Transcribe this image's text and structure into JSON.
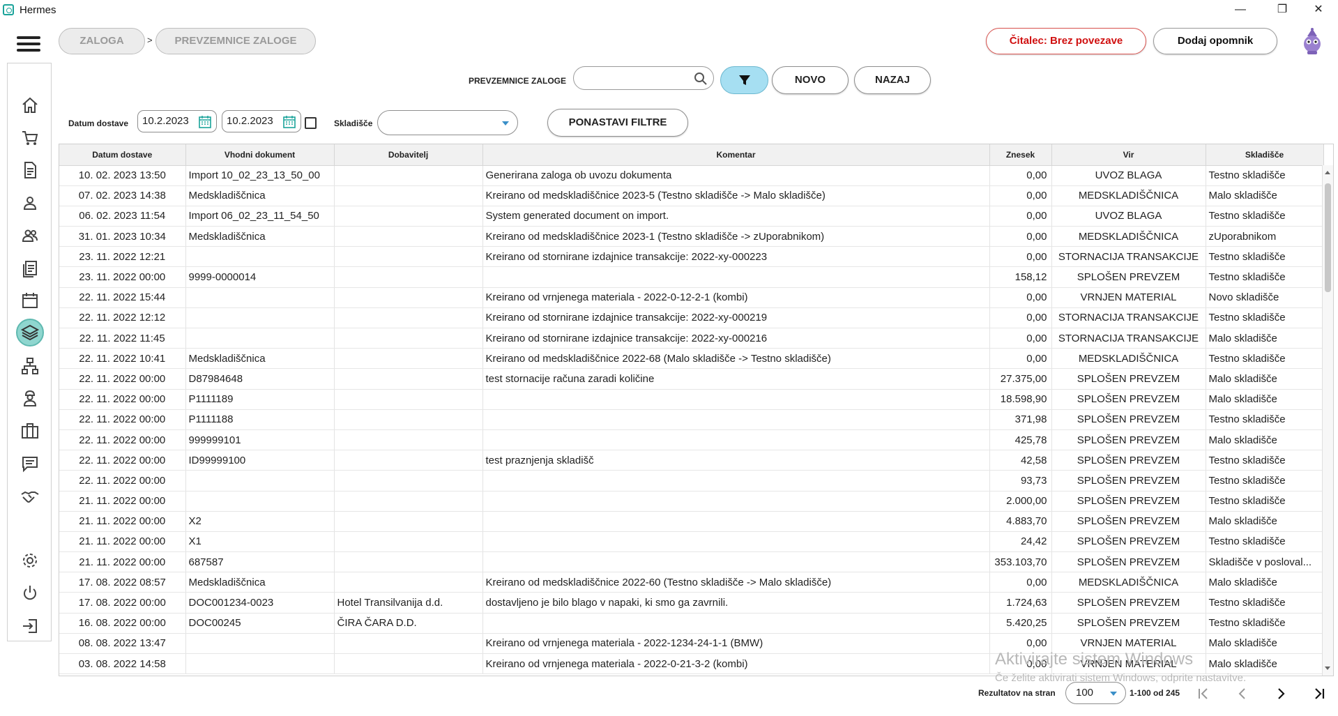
{
  "window": {
    "title": "Hermes",
    "minimize": "—",
    "restore": "❐",
    "close": "✕"
  },
  "breadcrumb": {
    "items": [
      "ZALOGA",
      "PREVZEMNICE ZALOGE"
    ],
    "separator": ">"
  },
  "header": {
    "reader_status": "Čitalec: Brez povezave",
    "reader_color": "#d01010",
    "add_reminder": "Dodaj opomnik"
  },
  "sidebar": {
    "items": [
      {
        "icon": "home-icon"
      },
      {
        "icon": "cart-icon"
      },
      {
        "icon": "document-icon"
      },
      {
        "icon": "person-icon"
      },
      {
        "icon": "people-icon"
      },
      {
        "icon": "list-icon"
      },
      {
        "icon": "calendar-icon"
      },
      {
        "icon": "layers-icon",
        "active": true
      },
      {
        "icon": "network-icon"
      },
      {
        "icon": "worker-icon"
      },
      {
        "icon": "briefcase-icon"
      },
      {
        "icon": "chat-icon"
      },
      {
        "icon": "handshake-icon"
      },
      {
        "icon": "gear-icon"
      },
      {
        "icon": "power-icon"
      },
      {
        "icon": "logout-icon"
      }
    ],
    "accent": "#8fd6cf"
  },
  "toolbar": {
    "search_label": "PREVZEMNICE ZALOGE",
    "search_value": "",
    "new_label": "NOVO",
    "back_label": "NAZAJ",
    "filter_color": "#a6dff2"
  },
  "filters": {
    "date_label": "Datum dostave",
    "date_from": "10.2.2023",
    "date_to": "10.2.2023",
    "warehouse_label": "Skladišče",
    "warehouse_value": "",
    "reset_label": "PONASTAVI FILTRE"
  },
  "table": {
    "columns": [
      "Datum dostave",
      "Vhodni dokument",
      "Dobavitelj",
      "Komentar",
      "Znesek",
      "Vir",
      "Skladišče"
    ],
    "rows": [
      [
        "10. 02. 2023 13:50",
        "Import 10_02_23_13_50_00",
        "",
        "Generirana zaloga ob uvozu dokumenta",
        "0,00",
        "UVOZ BLAGA",
        "Testno skladišče"
      ],
      [
        "07. 02. 2023 14:38",
        "Medskladiščnica",
        "",
        "Kreirano od medskladiščnice 2023-5 (Testno skladišče -> Malo skladišče)",
        "0,00",
        "MEDSKLADIŠČNICA",
        "Malo skladišče"
      ],
      [
        "06. 02. 2023 11:54",
        "Import 06_02_23_11_54_50",
        "",
        "System generated document on import.",
        "0,00",
        "UVOZ BLAGA",
        "Testno skladišče"
      ],
      [
        "31. 01. 2023 10:34",
        "Medskladiščnica",
        "",
        "Kreirano od medskladiščnice 2023-1 (Testno skladišče -> zUporabnikom)",
        "0,00",
        "MEDSKLADIŠČNICA",
        "zUporabnikom"
      ],
      [
        "23. 11. 2022 12:21",
        "",
        "",
        "Kreirano od stornirane izdajnice transakcije: 2022-xy-000223",
        "0,00",
        "STORNACIJA TRANSAKCIJE",
        "Testno skladišče"
      ],
      [
        "23. 11. 2022 00:00",
        "9999-0000014",
        "",
        "",
        "158,12",
        "SPLOŠEN PREVZEM",
        "Testno skladišče"
      ],
      [
        "22. 11. 2022 15:44",
        "",
        "",
        "Kreirano od vrnjenega materiala - 2022-0-12-2-1 (kombi)",
        "0,00",
        "VRNJEN MATERIAL",
        "Novo skladišče"
      ],
      [
        "22. 11. 2022 12:12",
        "",
        "",
        "Kreirano od stornirane izdajnice transakcije: 2022-xy-000219",
        "0,00",
        "STORNACIJA TRANSAKCIJE",
        "Testno skladišče"
      ],
      [
        "22. 11. 2022 11:45",
        "",
        "",
        "Kreirano od stornirane izdajnice transakcije: 2022-xy-000216",
        "0,00",
        "STORNACIJA TRANSAKCIJE",
        "Malo skladišče"
      ],
      [
        "22. 11. 2022 10:41",
        "Medskladiščnica",
        "",
        "Kreirano od medskladiščnice 2022-68 (Malo skladišče -> Testno skladišče)",
        "0,00",
        "MEDSKLADIŠČNICA",
        "Testno skladišče"
      ],
      [
        "22. 11. 2022 00:00",
        "D87984648",
        "",
        "test stornacije računa zaradi količine",
        "27.375,00",
        "SPLOŠEN PREVZEM",
        "Malo skladišče"
      ],
      [
        "22. 11. 2022 00:00",
        "P1111189",
        "",
        "",
        "18.598,90",
        "SPLOŠEN PREVZEM",
        "Malo skladišče"
      ],
      [
        "22. 11. 2022 00:00",
        "P1111188",
        "",
        "",
        "371,98",
        "SPLOŠEN PREVZEM",
        "Testno skladišče"
      ],
      [
        "22. 11. 2022 00:00",
        "999999101",
        "",
        "",
        "425,78",
        "SPLOŠEN PREVZEM",
        "Malo skladišče"
      ],
      [
        "22. 11. 2022 00:00",
        "ID99999100",
        "",
        "test praznjenja skladišč",
        "42,58",
        "SPLOŠEN PREVZEM",
        "Testno skladišče"
      ],
      [
        "22. 11. 2022 00:00",
        "",
        "",
        "",
        "93,73",
        "SPLOŠEN PREVZEM",
        "Testno skladišče"
      ],
      [
        "21. 11. 2022 00:00",
        "",
        "",
        "",
        "2.000,00",
        "SPLOŠEN PREVZEM",
        "Testno skladišče"
      ],
      [
        "21. 11. 2022 00:00",
        "X2",
        "",
        "",
        "4.883,70",
        "SPLOŠEN PREVZEM",
        "Malo skladišče"
      ],
      [
        "21. 11. 2022 00:00",
        "X1",
        "",
        "",
        "24,42",
        "SPLOŠEN PREVZEM",
        "Testno skladišče"
      ],
      [
        "21. 11. 2022 00:00",
        "687587",
        "",
        "",
        "353.103,70",
        "SPLOŠEN PREVZEM",
        "Skladišče v posloval..."
      ],
      [
        "17. 08. 2022 08:57",
        "Medskladiščnica",
        "",
        "Kreirano od medskladiščnice 2022-60 (Testno skladišče -> Malo skladišče)",
        "0,00",
        "MEDSKLADIŠČNICA",
        "Malo skladišče"
      ],
      [
        "17. 08. 2022 00:00",
        "DOC001234-0023",
        "Hotel Transilvanija d.d.",
        "dostavljeno je bilo blago v napaki, ki smo ga zavrnili.",
        "1.724,63",
        "SPLOŠEN PREVZEM",
        "Testno skladišče"
      ],
      [
        "16. 08. 2022 00:00",
        "DOC00245",
        "ČIRA ČARA D.D.",
        "",
        "5.420,25",
        "SPLOŠEN PREVZEM",
        "Testno skladišče"
      ],
      [
        "08. 08. 2022 13:47",
        "",
        "",
        "Kreirano od vrnjenega materiala - 2022-1234-24-1-1 (BMW)",
        "0,00",
        "VRNJEN MATERIAL",
        "Malo skladišče"
      ],
      [
        "03. 08. 2022 14:58",
        "",
        "",
        "Kreirano od vrnjenega materiala - 2022-0-21-3-2 (kombi)",
        "0,00",
        "VRNJEN MATERIAL",
        "Malo skladišče"
      ]
    ]
  },
  "watermark": {
    "line1": "Aktivirajte sistem Windows",
    "line2": "Če želite aktivirati sistem Windows, odprite nastavitve."
  },
  "pagination": {
    "label": "Rezultatov na stran",
    "page_size": "100",
    "range": "1-100 od 245"
  }
}
